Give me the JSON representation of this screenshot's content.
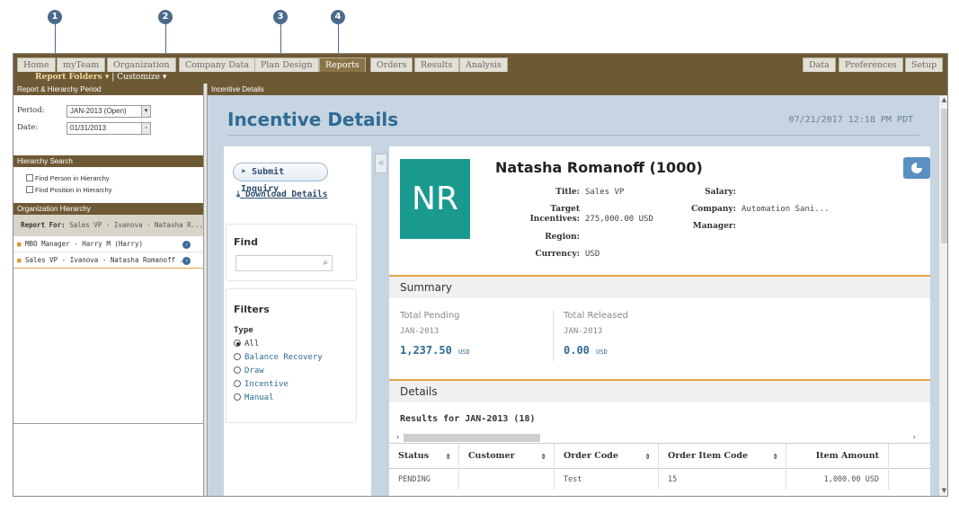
{
  "callouts": [
    "1",
    "2",
    "3",
    "4"
  ],
  "tabs": {
    "left": [
      "Home",
      "myTeam",
      "Organization",
      "Company Data",
      "Plan Design",
      "Reports",
      "Orders",
      "Results",
      "Analysis"
    ],
    "right": [
      "Data",
      "Preferences",
      "Setup"
    ],
    "active": "Reports"
  },
  "subnav": {
    "report_folders": "Report Folders",
    "separator": "|",
    "customize": "Customize"
  },
  "left_panel": {
    "period_section": {
      "header": "Report & Hierarchy Period",
      "period_label": "Period:",
      "period_value": "JAN-2013 (Open)",
      "date_label": "Date:",
      "date_value": "01/31/2013"
    },
    "hierarchy_search": {
      "header": "Hierarchy Search",
      "items": [
        "Find Person in Hierarchy",
        "Find Position in Hierarchy"
      ]
    },
    "org_hierarchy": {
      "header": "Organization Hierarchy",
      "report_for_label": "Report For:",
      "report_for_value": "Sales VP - Ivanova - Natasha R...",
      "items": [
        "MBO Manager - Harry M (Harry)",
        "Sales VP - Ivanova - Natasha Romanoff ..."
      ]
    }
  },
  "right_pane": {
    "header": "Incentive Details",
    "title": "Incentive Details",
    "timestamp": "07/21/2017 12:18 PM PDT"
  },
  "actions": {
    "submit_inquiry": "Submit Inquiry",
    "download_details": "Download Details"
  },
  "find": {
    "title": "Find",
    "placeholder": ""
  },
  "filters": {
    "title": "Filters",
    "type_label": "Type",
    "options": [
      "All",
      "Balance Recovery",
      "Draw",
      "Incentive",
      "Manual"
    ],
    "selected": "All"
  },
  "person": {
    "initials": "NR",
    "avatar_color": "#1a9a8f",
    "name": "Natasha Romanoff (1000)",
    "title_label": "Title:",
    "title_value": "Sales VP",
    "target_label_1": "Target",
    "target_label_2": "Incentives:",
    "target_value": "275,000.00 USD",
    "region_label": "Region:",
    "region_value": "",
    "currency_label": "Currency:",
    "currency_value": "USD",
    "salary_label": "Salary:",
    "salary_value": "",
    "company_label": "Company:",
    "company_value": "Automation Sani...",
    "manager_label": "Manager:",
    "manager_value": ""
  },
  "summary": {
    "title": "Summary",
    "pending_label": "Total Pending",
    "pending_period": "JAN-2013",
    "pending_amount": "1,237.50",
    "pending_currency": "USD",
    "released_label": "Total Released",
    "released_period": "JAN-2013",
    "released_amount": "0.00",
    "released_currency": "USD"
  },
  "details": {
    "title": "Details",
    "results_text": "Results for JAN-2013 (18)",
    "columns": [
      "Status",
      "Customer",
      "Order Code",
      "Order Item Code",
      "Item Amount"
    ],
    "rows": [
      [
        "PENDING",
        "",
        "Test",
        "15",
        "1,000.00 USD"
      ]
    ]
  },
  "colors": {
    "accent_brown": "#6d5a35",
    "title_blue": "#2f6b94",
    "summary_orange": "#e5a24a"
  }
}
